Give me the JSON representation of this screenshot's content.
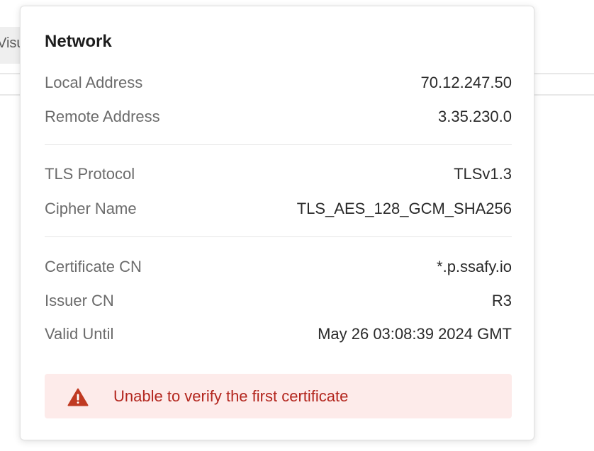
{
  "background": {
    "tab_label": "Visu"
  },
  "network": {
    "title": "Network",
    "rows": [
      {
        "label": "Local Address",
        "value": "70.12.247.50"
      },
      {
        "label": "Remote Address",
        "value": "3.35.230.0"
      },
      {
        "label": "TLS Protocol",
        "value": "TLSv1.3"
      },
      {
        "label": "Cipher Name",
        "value": "TLS_AES_128_GCM_SHA256"
      },
      {
        "label": "Certificate CN",
        "value": "*.p.ssafy.io"
      },
      {
        "label": "Issuer CN",
        "value": "R3"
      },
      {
        "label": "Valid Until",
        "value": "May 26 03:08:39 2024 GMT"
      }
    ],
    "error": {
      "icon": "warning-triangle-icon",
      "message": "Unable to verify the first certificate",
      "color": "#b3261e",
      "background": "#fdebea"
    }
  }
}
